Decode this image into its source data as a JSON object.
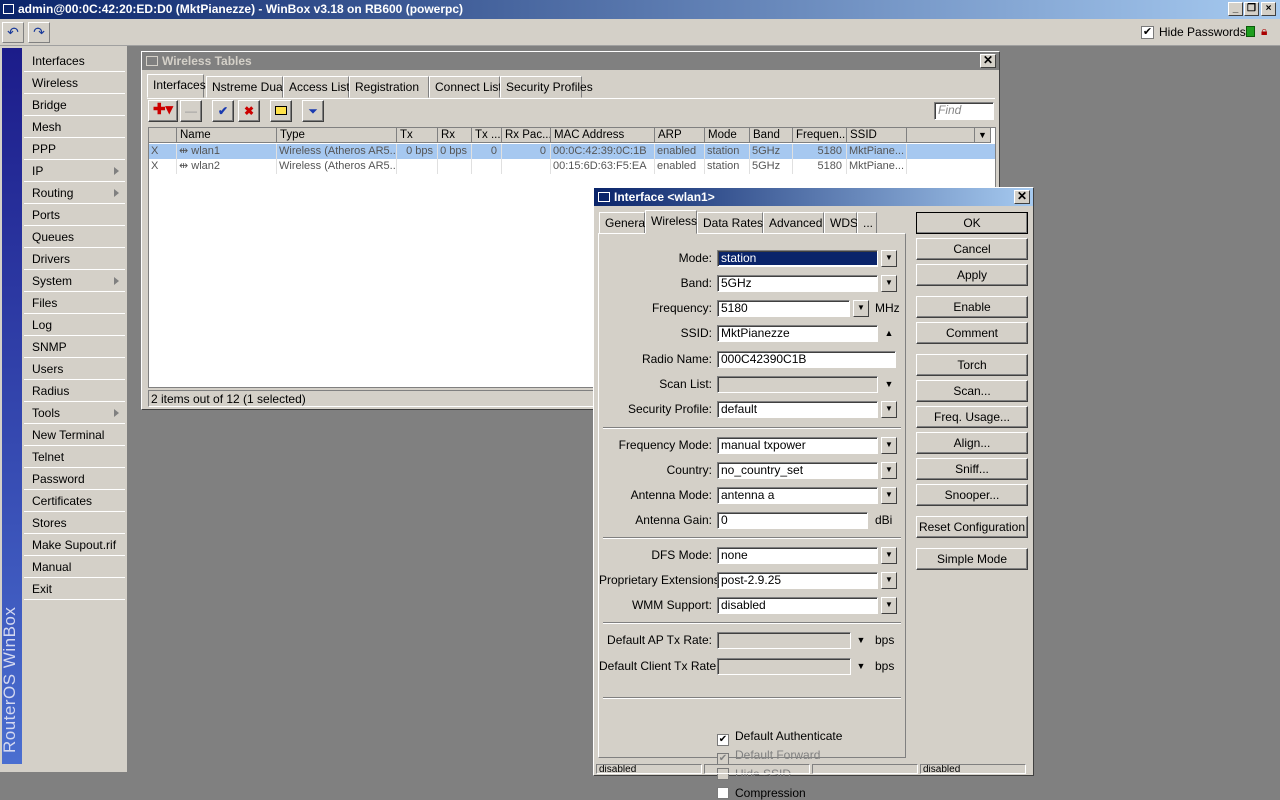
{
  "window": {
    "title": "admin@00:0C:42:20:ED:D0 (MktPianezze) - WinBox v3.18 on RB600 (powerpc)"
  },
  "toolbar": {
    "hide_passwords_label": "Hide Passwords",
    "hide_passwords_checked": true
  },
  "sidebar": {
    "brand": "RouterOS WinBox",
    "items": [
      {
        "label": "Interfaces"
      },
      {
        "label": "Wireless"
      },
      {
        "label": "Bridge"
      },
      {
        "label": "Mesh"
      },
      {
        "label": "PPP"
      },
      {
        "label": "IP",
        "submenu": true
      },
      {
        "label": "Routing",
        "submenu": true
      },
      {
        "label": "Ports"
      },
      {
        "label": "Queues"
      },
      {
        "label": "Drivers"
      },
      {
        "label": "System",
        "submenu": true
      },
      {
        "label": "Files"
      },
      {
        "label": "Log"
      },
      {
        "label": "SNMP"
      },
      {
        "label": "Users"
      },
      {
        "label": "Radius"
      },
      {
        "label": "Tools",
        "submenu": true
      },
      {
        "label": "New Terminal"
      },
      {
        "label": "Telnet"
      },
      {
        "label": "Password"
      },
      {
        "label": "Certificates"
      },
      {
        "label": "Stores"
      },
      {
        "label": "Make Supout.rif"
      },
      {
        "label": "Manual"
      },
      {
        "label": "Exit"
      }
    ]
  },
  "wireless_tables": {
    "title": "Wireless Tables",
    "tabs": [
      "Interfaces",
      "Nstreme Dual",
      "Access List",
      "Registration",
      "Connect List",
      "Security Profiles"
    ],
    "active_tab": "Interfaces",
    "find_placeholder": "Find",
    "columns": [
      "",
      "Name",
      "Type",
      "Tx",
      "Rx",
      "Tx ...",
      "Rx Pac...",
      "MAC Address",
      "ARP",
      "Mode",
      "Band",
      "Frequen...",
      "SSID"
    ],
    "rows": [
      {
        "flag": "X",
        "name": "wlan1",
        "type": "Wireless (Atheros AR5...",
        "tx": "0 bps",
        "rx": "0 bps",
        "txp": "0",
        "rxp": "0",
        "mac": "00:0C:42:39:0C:1B",
        "arp": "enabled",
        "mode": "station",
        "band": "5GHz",
        "freq": "5180",
        "ssid": "MktPiane...",
        "selected": true
      },
      {
        "flag": "X",
        "name": "wlan2",
        "type": "Wireless (Atheros AR5...",
        "tx": "",
        "rx": "",
        "txp": "",
        "rxp": "",
        "mac": "00:15:6D:63:F5:EA",
        "arp": "enabled",
        "mode": "station",
        "band": "5GHz",
        "freq": "5180",
        "ssid": "MktPiane...",
        "selected": false
      }
    ],
    "status": "2 items out of 12 (1 selected)"
  },
  "interface_dialog": {
    "title": "Interface <wlan1>",
    "tabs": [
      "General",
      "Wireless",
      "Data Rates",
      "Advanced",
      "WDS",
      "..."
    ],
    "active_tab": "Wireless",
    "fields": {
      "mode": {
        "label": "Mode:",
        "value": "station"
      },
      "band": {
        "label": "Band:",
        "value": "5GHz"
      },
      "frequency": {
        "label": "Frequency:",
        "value": "5180",
        "unit": "MHz"
      },
      "ssid": {
        "label": "SSID:",
        "value": "MktPianezze"
      },
      "radio_name": {
        "label": "Radio Name:",
        "value": "000C42390C1B"
      },
      "scan_list": {
        "label": "Scan List:",
        "value": ""
      },
      "security_profile": {
        "label": "Security Profile:",
        "value": "default"
      },
      "frequency_mode": {
        "label": "Frequency Mode:",
        "value": "manual txpower"
      },
      "country": {
        "label": "Country:",
        "value": "no_country_set"
      },
      "antenna_mode": {
        "label": "Antenna Mode:",
        "value": "antenna a"
      },
      "antenna_gain": {
        "label": "Antenna Gain:",
        "value": "0",
        "unit": "dBi"
      },
      "dfs_mode": {
        "label": "DFS Mode:",
        "value": "none"
      },
      "proprietary_extensions": {
        "label": "Proprietary Extensions:",
        "value": "post-2.9.25"
      },
      "wmm_support": {
        "label": "WMM Support:",
        "value": "disabled"
      },
      "default_ap_tx_rate": {
        "label": "Default AP Tx Rate:",
        "value": "",
        "unit": "bps"
      },
      "default_client_tx_rate": {
        "label": "Default Client Tx Rate:",
        "value": "",
        "unit": "bps"
      }
    },
    "checkboxes": [
      {
        "label": "Default Authenticate",
        "checked": true,
        "enabled": true
      },
      {
        "label": "Default Forward",
        "checked": true,
        "enabled": false
      },
      {
        "label": "Hide SSID",
        "checked": false,
        "enabled": false
      },
      {
        "label": "Compression",
        "checked": false,
        "enabled": true
      }
    ],
    "buttons": [
      "OK",
      "Cancel",
      "Apply",
      "Enable",
      "Comment",
      "Torch",
      "Scan...",
      "Freq. Usage...",
      "Align...",
      "Sniff...",
      "Snooper...",
      "Reset Configuration",
      "Simple Mode"
    ],
    "status_bar": [
      "disabled",
      "",
      "",
      "disabled"
    ]
  },
  "colors": {
    "title_active": "#0a246a",
    "title_inactive": "#808080",
    "selection": "#0a246a",
    "panel": "#d4d0c8"
  }
}
